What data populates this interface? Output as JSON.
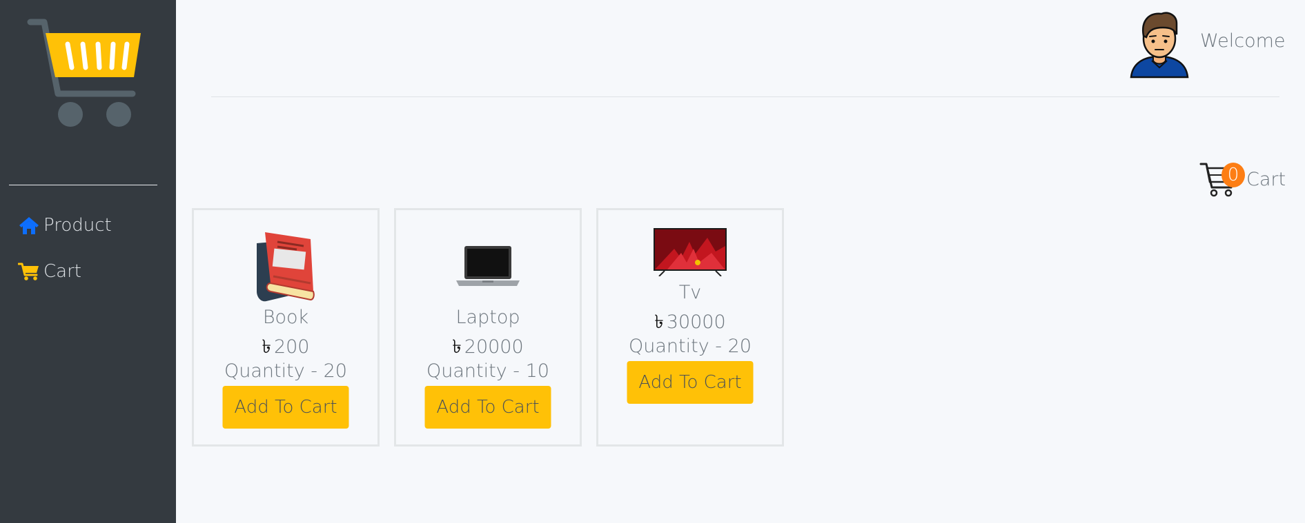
{
  "sidebar": {
    "logo_icon": "shopping-basket-logo",
    "items": [
      {
        "label": "Product",
        "icon": "home-icon"
      },
      {
        "label": "Cart",
        "icon": "cart-icon"
      }
    ]
  },
  "header": {
    "welcome": "Welcome",
    "avatar_icon": "user-avatar"
  },
  "cart": {
    "count": "0",
    "label": "Cart"
  },
  "products": [
    {
      "name": "Book",
      "currency": "৳",
      "price": "200",
      "quantity": "Quantity - 20",
      "button": "Add To Cart"
    },
    {
      "name": "Laptop",
      "currency": "৳",
      "price": "20000",
      "quantity": "Quantity - 10",
      "button": "Add To Cart"
    },
    {
      "name": "Tv",
      "currency": "৳",
      "price": "30000",
      "quantity": "Quantity - 20",
      "button": "Add To Cart"
    }
  ],
  "colors": {
    "sidebar": "#343a40",
    "accent": "#ffc107",
    "badge": "#fd7e14",
    "nav_home_icon": "#0d6efd"
  }
}
